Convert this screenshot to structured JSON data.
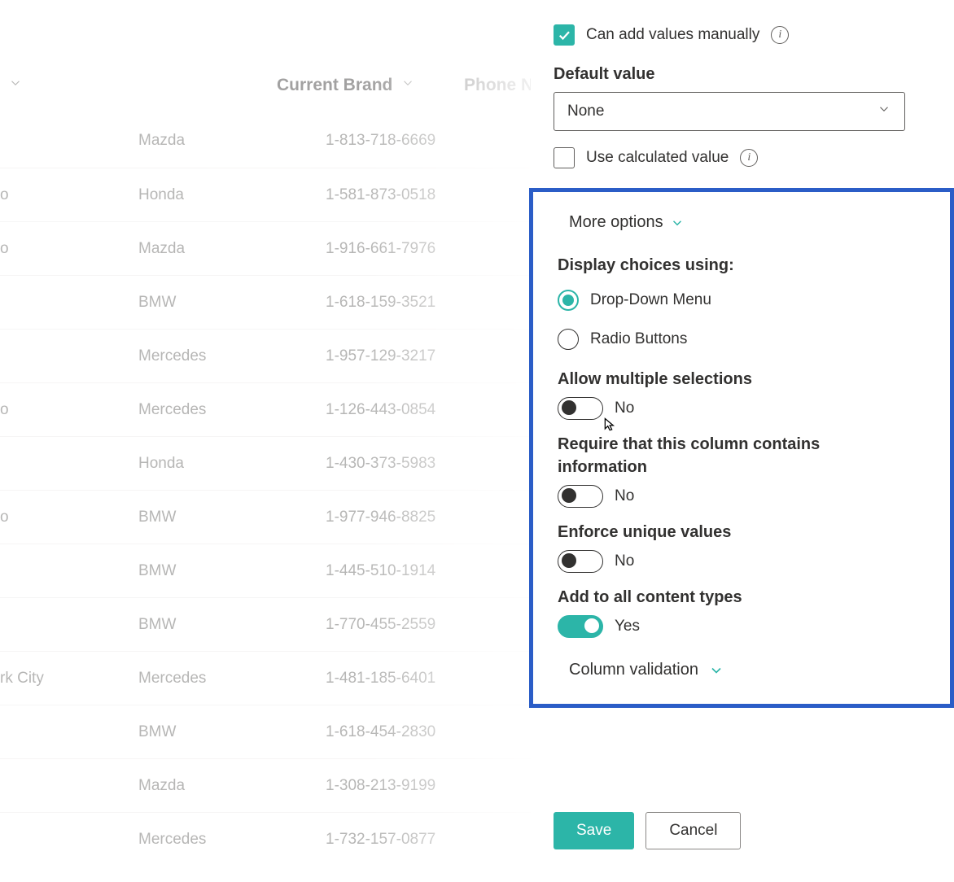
{
  "table": {
    "headers": {
      "brand": "Current Brand",
      "phone": "Phone Number"
    },
    "rows": [
      {
        "city": "",
        "brand": "Mazda",
        "phone": "1-813-718-6669"
      },
      {
        "city": "o",
        "brand": "Honda",
        "phone": "1-581-873-0518"
      },
      {
        "city": "o",
        "brand": "Mazda",
        "phone": "1-916-661-7976"
      },
      {
        "city": "",
        "brand": "BMW",
        "phone": "1-618-159-3521"
      },
      {
        "city": "",
        "brand": "Mercedes",
        "phone": "1-957-129-3217"
      },
      {
        "city": "o",
        "brand": "Mercedes",
        "phone": "1-126-443-0854"
      },
      {
        "city": "",
        "brand": "Honda",
        "phone": "1-430-373-5983"
      },
      {
        "city": "o",
        "brand": "BMW",
        "phone": "1-977-946-8825"
      },
      {
        "city": "",
        "brand": "BMW",
        "phone": "1-445-510-1914"
      },
      {
        "city": "",
        "brand": "BMW",
        "phone": "1-770-455-2559"
      },
      {
        "city": "rk City",
        "brand": "Mercedes",
        "phone": "1-481-185-6401"
      },
      {
        "city": "",
        "brand": "BMW",
        "phone": "1-618-454-2830"
      },
      {
        "city": "",
        "brand": "Mazda",
        "phone": "1-308-213-9199"
      },
      {
        "city": "",
        "brand": "Mercedes",
        "phone": "1-732-157-0877"
      }
    ]
  },
  "panel": {
    "can_add_manually": {
      "label": "Can add values manually",
      "checked": true
    },
    "default_value": {
      "label": "Default value",
      "value": "None"
    },
    "use_calculated": {
      "label": "Use calculated value",
      "checked": false
    },
    "more_options": "More options",
    "display_choices": {
      "label": "Display choices using:",
      "options": {
        "dropdown": "Drop-Down Menu",
        "radio": "Radio Buttons"
      },
      "selected": "dropdown"
    },
    "allow_multiple": {
      "label": "Allow multiple selections",
      "value": "No",
      "on": false
    },
    "require_info": {
      "label": "Require that this column contains information",
      "value": "No",
      "on": false
    },
    "enforce_unique": {
      "label": "Enforce unique values",
      "value": "No",
      "on": false
    },
    "all_content_types": {
      "label": "Add to all content types",
      "value": "Yes",
      "on": true
    },
    "column_validation": "Column validation"
  },
  "buttons": {
    "save": "Save",
    "cancel": "Cancel"
  }
}
